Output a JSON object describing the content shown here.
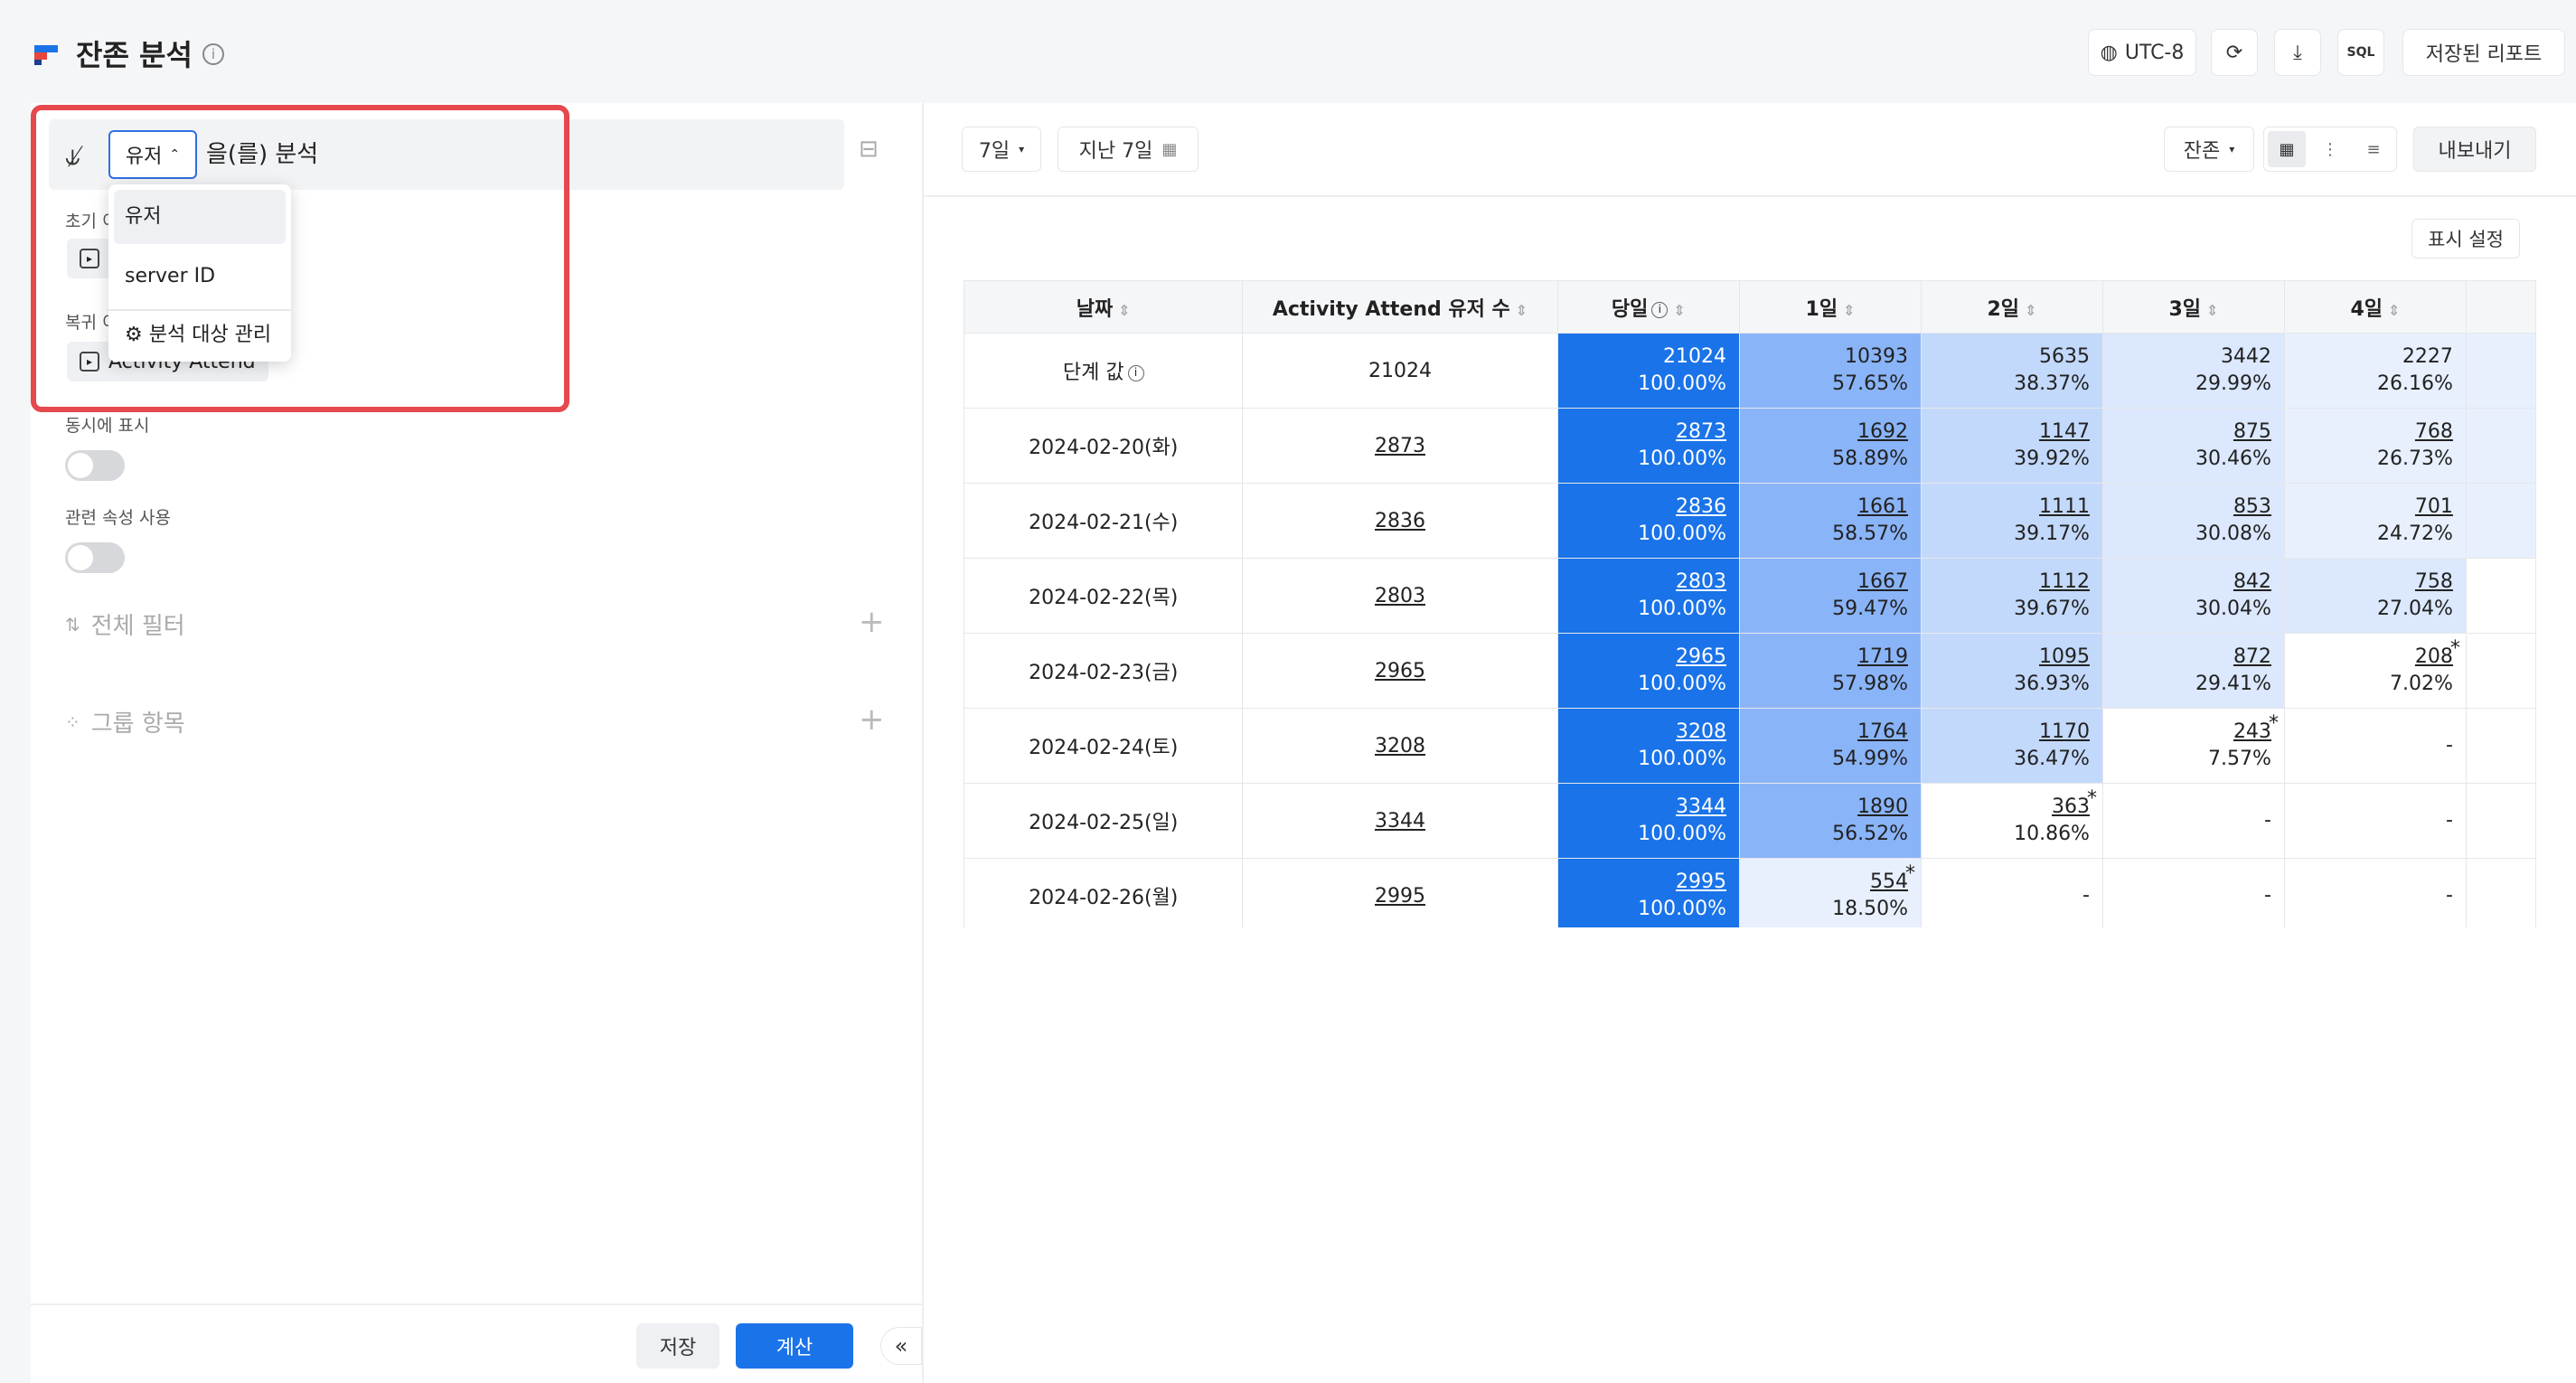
{
  "header": {
    "title": "잔존 분석",
    "timezone": "UTC-8",
    "sql_label": "SQL",
    "saved_reports": "저장된 리포트"
  },
  "left": {
    "subject_value": "유저",
    "subject_suffix": "을(를) 분석",
    "dropdown_items": [
      "유저",
      "server ID",
      "분석 대상 관리"
    ],
    "initial_event_label": "초기 이",
    "return_event_label": "복귀 이",
    "return_event_chip": "Activity Attend",
    "show_simultaneous_label": "동시에 표시",
    "related_property_label": "관련 속성 사용",
    "global_filter_label": "전체 필터",
    "group_items_label": "그룹 항목",
    "save_label": "저장",
    "calculate_label": "계산"
  },
  "toolbar": {
    "period": "7일",
    "date_range": "지난 7일",
    "metric": "잔존",
    "export": "내보내기",
    "display_settings": "표시 설정"
  },
  "table": {
    "headers": [
      "날짜",
      "Activity Attend 유저 수",
      "당일",
      "1일",
      "2일",
      "3일",
      "4일"
    ],
    "rows": [
      {
        "date": "단계 값",
        "count": "21024",
        "cells": [
          [
            "21024",
            "100.00%"
          ],
          [
            "10393",
            "57.65%"
          ],
          [
            "5635",
            "38.37%"
          ],
          [
            "3442",
            "29.99%"
          ],
          [
            "2227",
            "26.16%"
          ]
        ]
      },
      {
        "date": "2024-02-20(화)",
        "count": "2873",
        "cells": [
          [
            "2873",
            "100.00%"
          ],
          [
            "1692",
            "58.89%"
          ],
          [
            "1147",
            "39.92%"
          ],
          [
            "875",
            "30.46%"
          ],
          [
            "768",
            "26.73%"
          ]
        ]
      },
      {
        "date": "2024-02-21(수)",
        "count": "2836",
        "cells": [
          [
            "2836",
            "100.00%"
          ],
          [
            "1661",
            "58.57%"
          ],
          [
            "1111",
            "39.17%"
          ],
          [
            "853",
            "30.08%"
          ],
          [
            "701",
            "24.72%"
          ]
        ]
      },
      {
        "date": "2024-02-22(목)",
        "count": "2803",
        "cells": [
          [
            "2803",
            "100.00%"
          ],
          [
            "1667",
            "59.47%"
          ],
          [
            "1112",
            "39.67%"
          ],
          [
            "842",
            "30.04%"
          ],
          [
            "758",
            "27.04%"
          ]
        ]
      },
      {
        "date": "2024-02-23(금)",
        "count": "2965",
        "cells": [
          [
            "2965",
            "100.00%"
          ],
          [
            "1719",
            "57.98%"
          ],
          [
            "1095",
            "36.93%"
          ],
          [
            "872",
            "29.41%"
          ],
          [
            "208",
            "7.02%"
          ]
        ]
      },
      {
        "date": "2024-02-24(토)",
        "count": "3208",
        "cells": [
          [
            "3208",
            "100.00%"
          ],
          [
            "1764",
            "54.99%"
          ],
          [
            "1170",
            "36.47%"
          ],
          [
            "243",
            "7.57%"
          ],
          [
            "-",
            ""
          ]
        ]
      },
      {
        "date": "2024-02-25(일)",
        "count": "3344",
        "cells": [
          [
            "3344",
            "100.00%"
          ],
          [
            "1890",
            "56.52%"
          ],
          [
            "363",
            "10.86%"
          ],
          [
            "-",
            ""
          ],
          [
            "-",
            ""
          ]
        ]
      },
      {
        "date": "2024-02-26(월)",
        "count": "2995",
        "cells": [
          [
            "2995",
            "100.00%"
          ],
          [
            "554",
            "18.50%"
          ],
          [
            "-",
            ""
          ],
          [
            "-",
            ""
          ],
          [
            "-",
            ""
          ]
        ]
      }
    ]
  }
}
